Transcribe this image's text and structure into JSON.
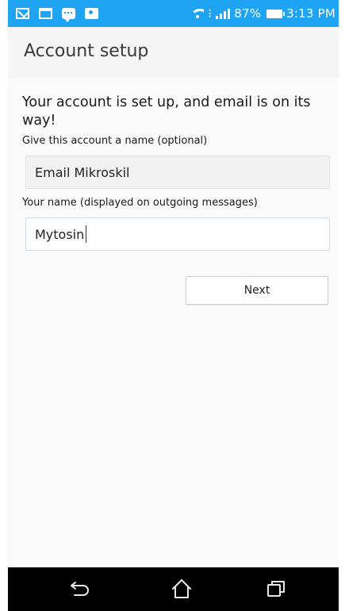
{
  "status_bar": {
    "notification_icons": [
      "mail-icon",
      "calendar-icon",
      "chat-icon",
      "photo-icon"
    ],
    "battery_percent": "87%",
    "time": "3:13 PM",
    "background_color": "#1fa4f3"
  },
  "header": {
    "title": "Account setup"
  },
  "main": {
    "headline": "Your account is set up, and email is on its way!",
    "account_name_label": "Give this account a name (optional)",
    "account_name_value": "Email Mikroskil",
    "your_name_label": "Your name (displayed on outgoing messages)",
    "your_name_value": "Mytosin",
    "next_button": "Next"
  },
  "nav_bar": {
    "icons": [
      "back-icon",
      "home-icon",
      "recent-apps-icon"
    ]
  }
}
